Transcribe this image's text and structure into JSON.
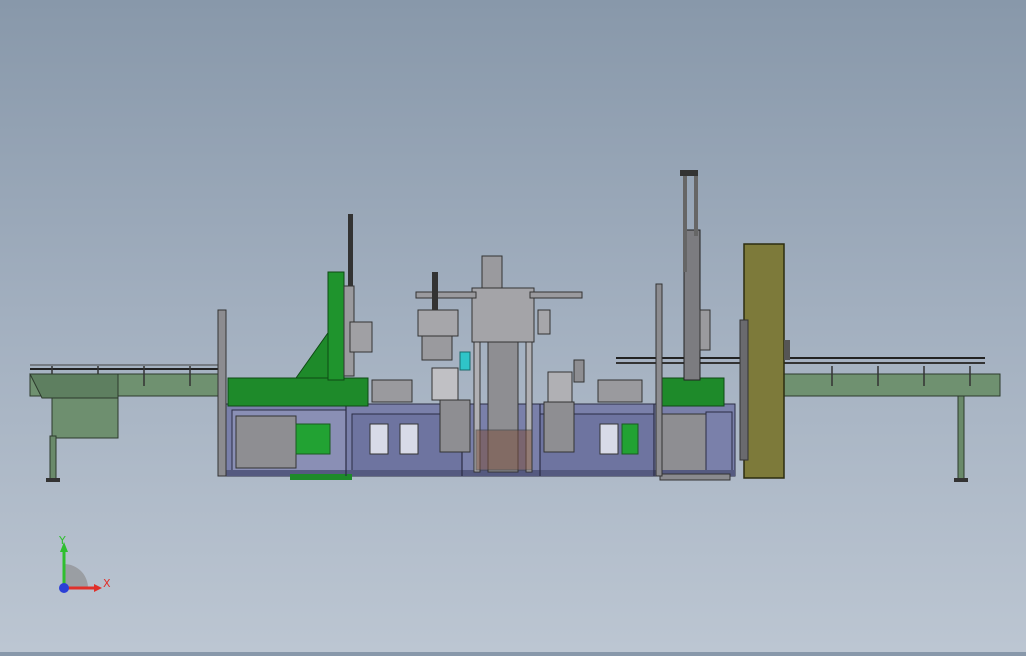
{
  "triad": {
    "y_label": "Y",
    "x_label": "X"
  },
  "colors": {
    "background_top": "#8898aa",
    "background_bottom": "#bcc6d2",
    "machine_green": "#1e8a2a",
    "conveyor_green": "#6f9170",
    "frame_blue": "#7079a8",
    "housing_olive": "#7d7a3a",
    "steel_gray": "#8e8e92",
    "axis_y": "#2fbf2f",
    "axis_x": "#e0302a",
    "axis_z": "#2b3fd6"
  }
}
